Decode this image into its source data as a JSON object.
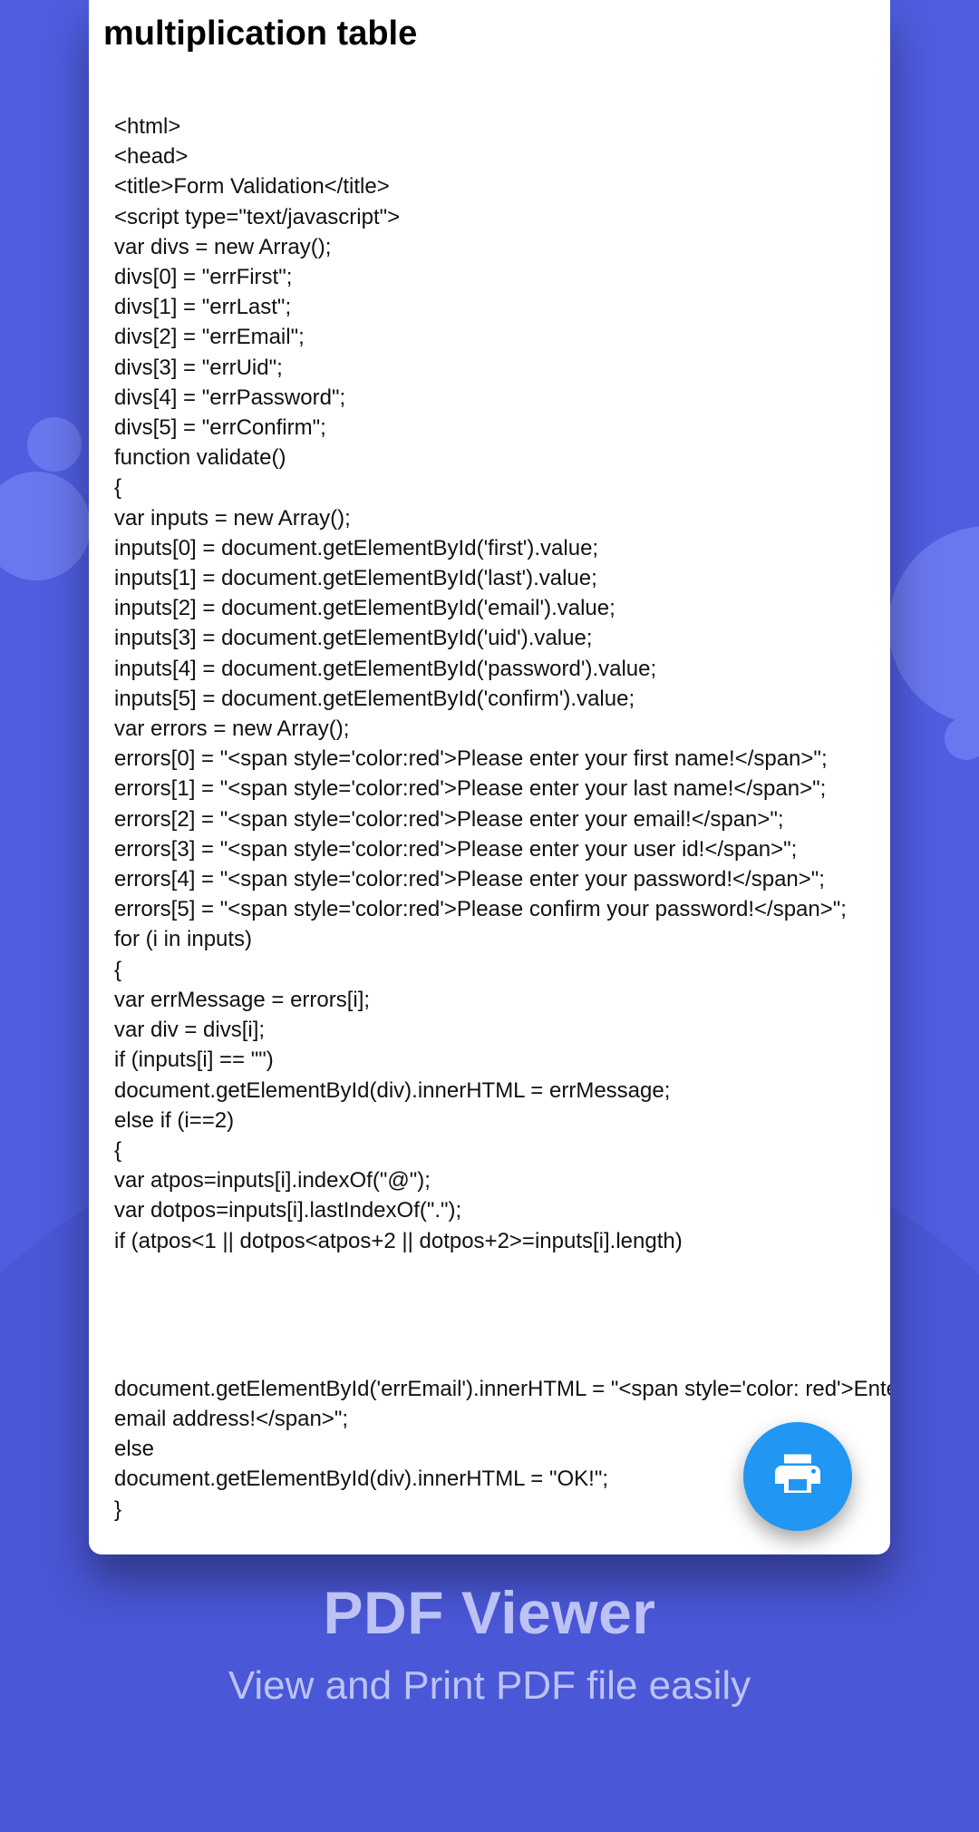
{
  "document": {
    "title": "multiplication table",
    "code_lines": [
      "<html>",
      "<head>",
      "<title>Form Validation</title>",
      "<script type=\"text/javascript\">",
      "var divs = new Array();",
      "divs[0] = \"errFirst\";",
      "divs[1] = \"errLast\";",
      "divs[2] = \"errEmail\";",
      "divs[3] = \"errUid\";",
      "divs[4] = \"errPassword\";",
      "divs[5] = \"errConfirm\";",
      "function validate()",
      "{",
      "var inputs = new Array();",
      "inputs[0] = document.getElementById('first').value;",
      "inputs[1] = document.getElementById('last').value;",
      "inputs[2] = document.getElementById('email').value;",
      "inputs[3] = document.getElementById('uid').value;",
      "inputs[4] = document.getElementById('password').value;",
      "inputs[5] = document.getElementById('confirm').value;",
      "var errors = new Array();",
      "errors[0] = \"<span style='color:red'>Please enter your first name!</span>\";",
      "errors[1] = \"<span style='color:red'>Please enter your last name!</span>\";",
      "errors[2] = \"<span style='color:red'>Please enter your email!</span>\";",
      "errors[3] = \"<span style='color:red'>Please enter your user id!</span>\";",
      "errors[4] = \"<span style='color:red'>Please enter your password!</span>\";",
      "errors[5] = \"<span style='color:red'>Please confirm your password!</span>\";",
      "for (i in inputs)",
      "{",
      "var errMessage = errors[i];",
      "var div = divs[i];",
      "if (inputs[i] == \"\")",
      "document.getElementById(div).innerHTML = errMessage;",
      "else if (i==2)",
      "{",
      "var atpos=inputs[i].indexOf(\"@\");",
      "var dotpos=inputs[i].lastIndexOf(\".\");",
      "if (atpos<1 || dotpos<atpos+2 || dotpos+2>=inputs[i].length)"
    ],
    "code_lines_after_gap": [
      "document.getElementById('errEmail').innerHTML = \"<span style='color: red'>Enter a va",
      "email address!</span>\";",
      "else",
      "document.getElementById(div).innerHTML = \"OK!\";",
      "}"
    ]
  },
  "fab": {
    "icon": "print-icon"
  },
  "promo": {
    "title": "PDF Viewer",
    "subtitle": "View and Print PDF file easily"
  }
}
